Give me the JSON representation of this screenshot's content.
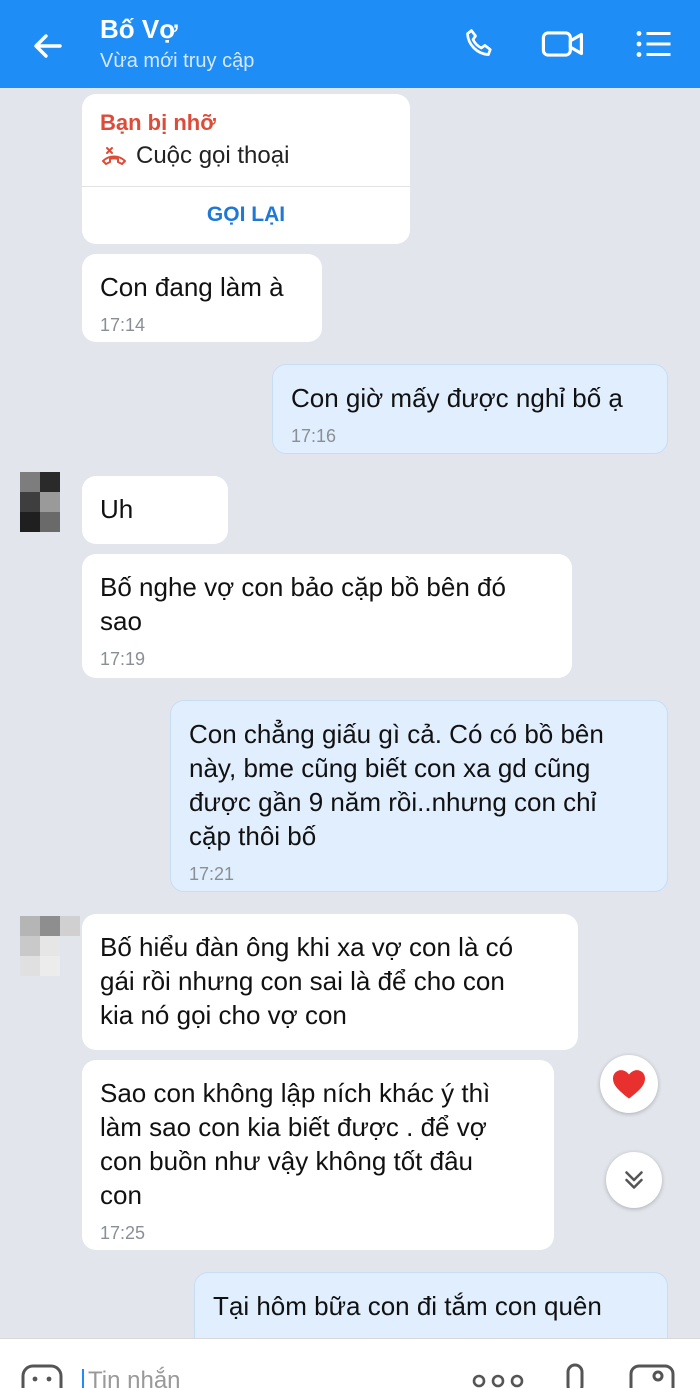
{
  "header": {
    "title": "Bố Vợ",
    "subtitle": "Vừa mới truy cập",
    "back_icon": "arrow-left-icon",
    "call_icon": "phone-icon",
    "video_icon": "video-camera-icon",
    "menu_icon": "list-menu-icon"
  },
  "missed_call": {
    "title": "Bạn bị nhỡ",
    "label": "Cuộc gọi thoại",
    "callback_label": "GỌI LẠI"
  },
  "messages": [
    {
      "text": "Con đang làm à",
      "time": "17:14"
    },
    {
      "text": "Con giờ mấy được nghỉ bố ạ",
      "time": "17:16"
    },
    {
      "text": "Uh",
      "time": ""
    },
    {
      "text": "Bố nghe vợ con bảo cặp bồ bên đó\nsao",
      "time": "17:19"
    },
    {
      "text": "Con chẳng giấu gì cả. Có có bồ bên\nnày, bme cũng biết con xa gd cũng\nđược gần 9 năm rồi..nhưng con chỉ\ncặp thôi bố",
      "time": "17:21"
    },
    {
      "text": "Bố hiểu đàn ông khi xa vợ con là có\ngái rồi nhưng con sai là để cho con\nkia nó gọi cho vợ con",
      "time": ""
    },
    {
      "text": "Sao con không lập ních khác ý thì\nlàm sao con kia biết được . để vợ\ncon buồn như vậy không tốt đâu\ncon",
      "time": "17:25"
    },
    {
      "text": "Tại hôm bữa con đi tắm con quên",
      "time": ""
    }
  ],
  "input": {
    "placeholder": "Tin nhắn"
  },
  "colors": {
    "header": "#1e8ef6",
    "incoming": "#ffffff",
    "outgoing": "#e0eefd",
    "background": "#e2e6ec",
    "missed": "#dd4b39"
  }
}
